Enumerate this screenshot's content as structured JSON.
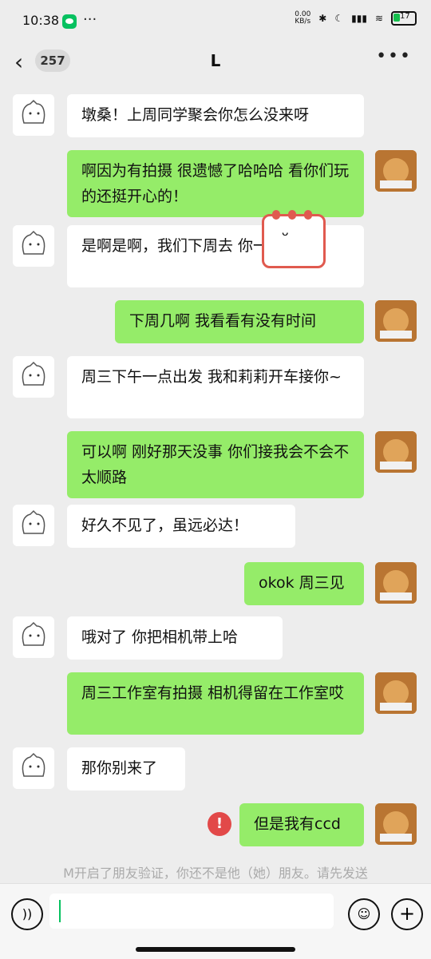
{
  "status": {
    "time": "10:38",
    "speed": "0.00",
    "speed_unit": "KB/s",
    "battery_text": "17"
  },
  "topbar": {
    "unread_badge": "257",
    "title": "L",
    "more": "•••"
  },
  "messages": [
    {
      "side": "left",
      "text": "墩桑！上周同学聚会你怎么没来呀"
    },
    {
      "side": "right",
      "text": "啊因为有拍摄 很遗憾了哈哈哈 看你们玩的还挺开心的！"
    },
    {
      "side": "left",
      "text": "是啊是啊，我们下周去 你一起来嘛！"
    },
    {
      "side": "right",
      "text": "下周几啊 我看看有没有时间"
    },
    {
      "side": "left",
      "text": "周三下午一点出发 我和莉莉开车接你~"
    },
    {
      "side": "right",
      "text": "可以啊 刚好那天没事 你们接我会不会不太顺路"
    },
    {
      "side": "left",
      "text": "好久不见了，虽远必达！"
    },
    {
      "side": "right",
      "text": "okok 周三见"
    },
    {
      "side": "left",
      "text": "哦对了 你把相机带上哈"
    },
    {
      "side": "right",
      "text": "周三工作室有拍摄 相机得留在工作室哎"
    },
    {
      "side": "left",
      "text": "那你别来了"
    },
    {
      "side": "right",
      "text": "但是我有ccd"
    }
  ],
  "notice": "M开启了朋友验证，你还不是他（她）朋友。请先发送",
  "error_icon": "!",
  "colors": {
    "bubble_right": "#95ec69",
    "bubble_left": "#ffffff",
    "background": "#ededed",
    "error": "#e24949"
  }
}
